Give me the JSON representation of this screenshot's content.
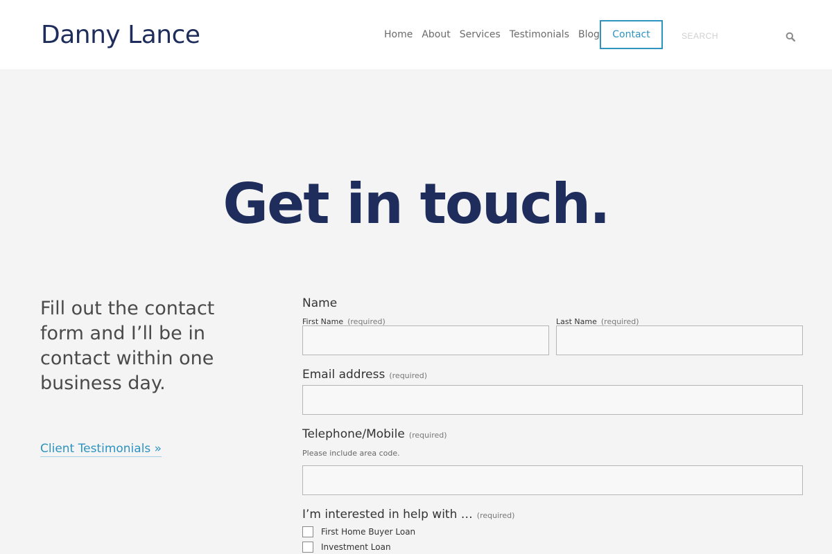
{
  "header": {
    "site_title": "Danny Lance",
    "nav": [
      "Home",
      "About",
      "Services",
      "Testimonials",
      "Blog"
    ],
    "contact_label": "Contact",
    "search_placeholder": "SEARCH"
  },
  "hero": {
    "title": "Get in touch."
  },
  "intro": {
    "text": "Fill out the contact form and I’ll be in contact within one business day.",
    "link_label": "Client Testimonials »"
  },
  "form": {
    "name": {
      "label": "Name",
      "first_label": "First Name",
      "first_required": "(required)",
      "last_label": "Last Name",
      "last_required": "(required)",
      "first_value": "",
      "last_value": ""
    },
    "email": {
      "label": "Email address",
      "required": "(required)",
      "value": ""
    },
    "phone": {
      "label": "Telephone/Mobile",
      "required": "(required)",
      "hint": "Please include area code.",
      "value": ""
    },
    "interest": {
      "label": "I’m interested in help with …",
      "required": "(required)",
      "options": [
        {
          "label": "First Home Buyer Loan",
          "checked": false
        },
        {
          "label": "Investment Loan",
          "checked": false
        }
      ]
    }
  },
  "colors": {
    "navy": "#1e2d5b",
    "accent": "#2d93c1",
    "background": "#f4f4f4"
  }
}
